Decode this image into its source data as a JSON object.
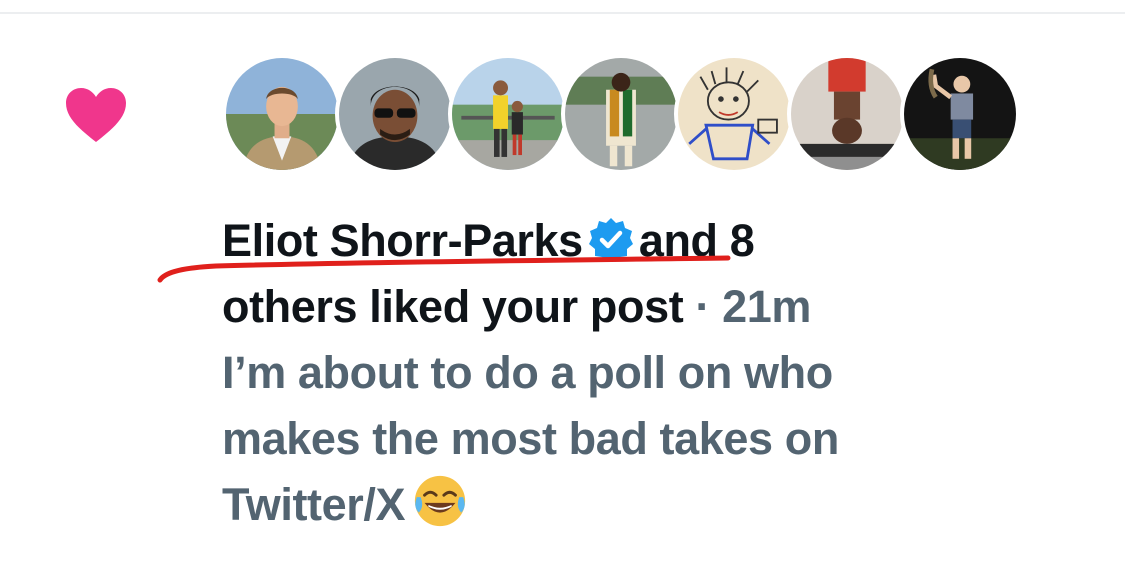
{
  "notification": {
    "type": "like",
    "icon": "heart-icon",
    "accent_color": "#f91880",
    "avatars": [
      {
        "icon": "avatar-man-in-suit"
      },
      {
        "icon": "avatar-man-with-sunglasses"
      },
      {
        "icon": "avatar-two-people-outdoors"
      },
      {
        "icon": "avatar-man-in-traditional-outfit"
      },
      {
        "icon": "avatar-drawing"
      },
      {
        "icon": "avatar-person-upside-down"
      },
      {
        "icon": "avatar-person-at-night"
      }
    ],
    "liker_name": "Eliot Shorr-Parks",
    "verified": true,
    "verified_color": "#1d9bf0",
    "others_text_line1": "and 8",
    "others_text_line2": "others liked your post",
    "separator": "·",
    "time": "21m",
    "post_lines": [
      "I’m about to do a poll on who",
      "makes the most bad takes on",
      "Twitter/X"
    ],
    "post_emoji": "face-with-tears-of-joy-icon",
    "annotation_color": "#e0201c"
  }
}
